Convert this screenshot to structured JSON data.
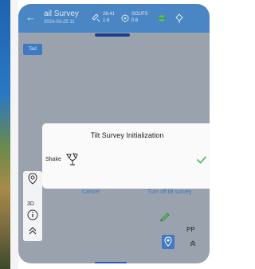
{
  "header": {
    "title": "ail Survey",
    "subtitle": "2024-03-25 11",
    "sat_value_1": "28:41",
    "sat_value_2": "1.6",
    "gps_value_1": "SOUFS",
    "gps_value_2": "0.6"
  },
  "tag_button": "Tad",
  "dialog": {
    "title": "Tilt Survey Initialization",
    "shake_label": "Shake",
    "cancel_label": "Cancel",
    "turn_off_label": "Turn off tilt survey"
  },
  "tools": {
    "label_3d": "3D"
  },
  "right": {
    "pp_label": "PP"
  },
  "colors": {
    "accent": "#3f74c9",
    "header_bg": "#4b86c4",
    "check": "#58b96b"
  },
  "icons": [
    "back-icon",
    "satellite-icon",
    "gps-icon",
    "link-icon",
    "signal-icon",
    "shake-icon",
    "check-icon",
    "layers-icon",
    "info-icon",
    "chevron-up-icon",
    "pencil-icon",
    "target-icon"
  ]
}
